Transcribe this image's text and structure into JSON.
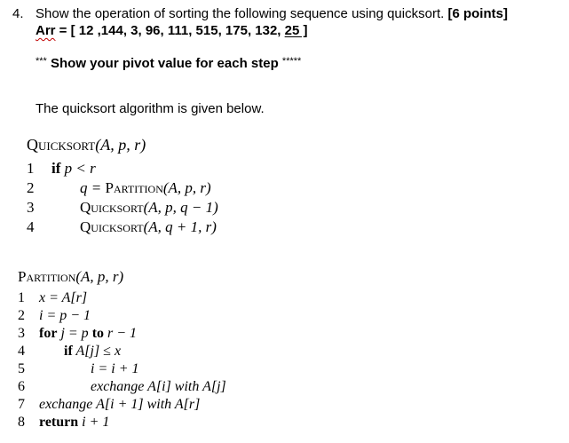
{
  "question": {
    "number": "4.",
    "text": "Show the operation of sorting the following sequence using quicksort.",
    "points": "[6 points]",
    "array_label": "Arr",
    "array_prefix": " = [ 12 ,144, 3, 96, 111, 515, 175, 132, ",
    "array_last": "25 ]",
    "pivot_prefix": "***",
    "pivot_text": "Show your pivot value for each step",
    "pivot_suffix": "*****",
    "intro": "The quicksort algorithm is given below."
  },
  "quicksort": {
    "title": "Quicksort",
    "params": "(A, p, r)",
    "lines": [
      {
        "num": "1",
        "kw": "if",
        "text": " p < r"
      },
      {
        "num": "2",
        "pre": "q = ",
        "sc": "Partition",
        "post": "(A, p, r)"
      },
      {
        "num": "3",
        "pre": "",
        "sc": "Quicksort",
        "post": "(A, p, q − 1)"
      },
      {
        "num": "4",
        "pre": "",
        "sc": "Quicksort",
        "post": "(A, q + 1, r)"
      }
    ]
  },
  "partition": {
    "title": "Partition",
    "params": "(A, p, r)",
    "lines": [
      {
        "num": "1",
        "text": "x = A[r]"
      },
      {
        "num": "2",
        "text": "i = p − 1"
      },
      {
        "num": "3",
        "kw": "for",
        "text": " j = p ",
        "kw2": "to",
        "text2": " r − 1"
      },
      {
        "num": "4",
        "kw": "if",
        "text": " A[j] ≤ x"
      },
      {
        "num": "5",
        "text": "i = i + 1"
      },
      {
        "num": "6",
        "text": "exchange A[i] with A[j]"
      },
      {
        "num": "7",
        "text": "exchange A[i + 1] with A[r]"
      },
      {
        "num": "8",
        "kw": "return",
        "text": " i + 1"
      }
    ]
  }
}
